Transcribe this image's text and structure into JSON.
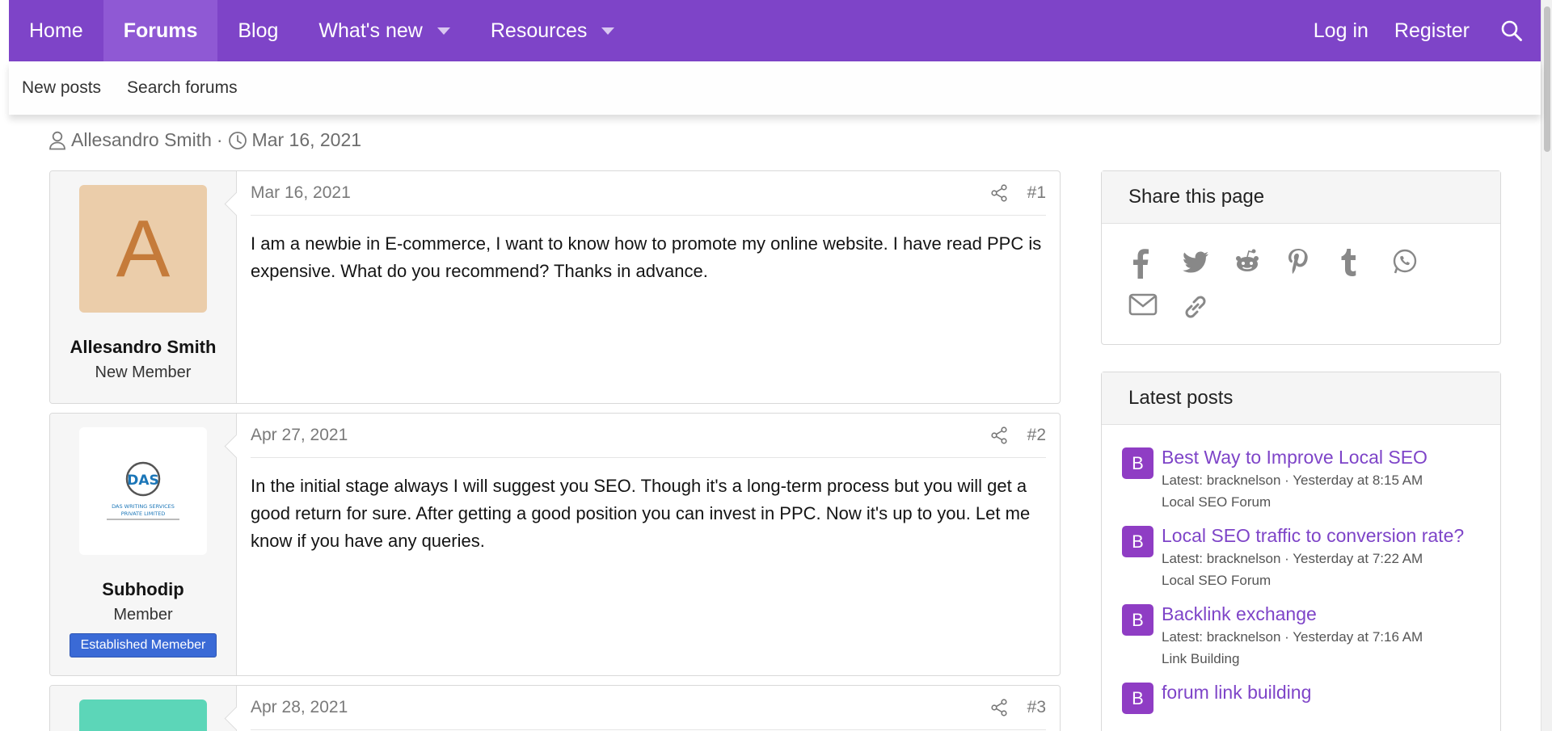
{
  "nav": {
    "items": [
      {
        "label": "Home",
        "active": false,
        "dropdown": false
      },
      {
        "label": "Forums",
        "active": true,
        "dropdown": false
      },
      {
        "label": "Blog",
        "active": false,
        "dropdown": false
      },
      {
        "label": "What's new",
        "active": false,
        "dropdown": true
      },
      {
        "label": "Resources",
        "active": false,
        "dropdown": true
      }
    ],
    "login": "Log in",
    "register": "Register",
    "accent": "#7e44c8"
  },
  "subnav": {
    "items": [
      "New posts",
      "Search forums"
    ]
  },
  "thread_meta": {
    "author": "Allesandro Smith",
    "separator": "·",
    "date": "Mar 16, 2021"
  },
  "posts": [
    {
      "date": "Mar 16, 2021",
      "number": "#1",
      "avatar_letter": "A",
      "username": "Allesandro Smith",
      "user_title": "New Member",
      "content": "I am a newbie in E-commerce, I want to know how to promote my online website. I have read PPC is expensive. What do you recommend? Thanks in advance."
    },
    {
      "date": "Apr 27, 2021",
      "number": "#2",
      "avatar_logo_text": "DAS",
      "avatar_logo_caption_1": "DAS WRITING SERVICES",
      "avatar_logo_caption_2": "PRIVATE LIMITED",
      "username": "Subhodip",
      "user_title": "Member",
      "badge": "Established Memeber",
      "content": "In the initial stage always I will suggest you SEO. Though it's a long-term process but you will get a good return for sure. After getting a good position you can invest in PPC. Now it's up to you. Let me know if you have any queries."
    },
    {
      "date": "Apr 28, 2021",
      "number": "#3"
    }
  ],
  "sidebar": {
    "share_title": "Share this page",
    "share_icons": [
      "facebook-icon",
      "twitter-icon",
      "reddit-icon",
      "pinterest-icon",
      "tumblr-icon",
      "whatsapp-icon",
      "email-icon",
      "link-icon"
    ],
    "latest_title": "Latest posts",
    "latest": [
      {
        "avatar": "B",
        "title": "Best Way to Improve Local SEO",
        "meta": "Latest: bracknelson · Yesterday at 8:15 AM",
        "forum": "Local SEO Forum"
      },
      {
        "avatar": "B",
        "title": "Local SEO traffic to conversion rate?",
        "meta": "Latest: bracknelson · Yesterday at 7:22 AM",
        "forum": "Local SEO Forum"
      },
      {
        "avatar": "B",
        "title": "Backlink exchange",
        "meta": "Latest: bracknelson · Yesterday at 7:16 AM",
        "forum": "Link Building"
      },
      {
        "avatar": "B",
        "title": "forum link building",
        "meta": "",
        "forum": ""
      }
    ]
  }
}
